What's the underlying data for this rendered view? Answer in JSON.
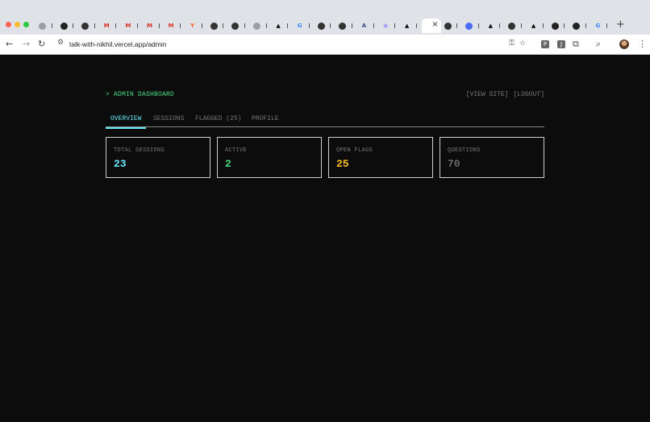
{
  "browser": {
    "tabs": [
      {
        "icon": "chrome-icon",
        "glyph": "",
        "color": "#9aa0a6"
      },
      {
        "icon": "github-icon",
        "glyph": "",
        "color": "#222222"
      },
      {
        "icon": "openai-icon",
        "glyph": "",
        "color": "#333333"
      },
      {
        "icon": "gmail-icon",
        "glyph": "M",
        "color": "#d93025"
      },
      {
        "icon": "gmail-icon",
        "glyph": "M",
        "color": "#d93025"
      },
      {
        "icon": "gmail-icon",
        "glyph": "M",
        "color": "#d93025"
      },
      {
        "icon": "gmail-icon",
        "glyph": "M",
        "color": "#d93025"
      },
      {
        "icon": "ycombinator-icon",
        "glyph": "Y",
        "color": "#f26522"
      },
      {
        "icon": "openai-icon",
        "glyph": "",
        "color": "#333333"
      },
      {
        "icon": "openai-icon",
        "glyph": "",
        "color": "#333333"
      },
      {
        "icon": "chrome-icon",
        "glyph": "",
        "color": "#9aa0a6"
      },
      {
        "icon": "vercel-icon",
        "glyph": "▲",
        "color": "#111111"
      },
      {
        "icon": "google-icon",
        "glyph": "G",
        "color": "#4285f4"
      },
      {
        "icon": "openai-icon",
        "glyph": "",
        "color": "#333333"
      },
      {
        "icon": "notion-icon",
        "glyph": "",
        "color": "#333333"
      },
      {
        "icon": "a-icon",
        "glyph": "A",
        "color": "#3b4a8c"
      },
      {
        "icon": "eye-icon",
        "glyph": "◉",
        "color": "#a78bfa"
      },
      {
        "icon": "vercel-icon",
        "glyph": "▲",
        "color": "#111111"
      },
      {
        "icon": "blank-icon",
        "glyph": "",
        "color": "#ffffff",
        "active": true
      },
      {
        "icon": "openai-icon",
        "glyph": "",
        "color": "#333333"
      },
      {
        "icon": "grid-icon",
        "glyph": "",
        "color": "#4a6cf7"
      },
      {
        "icon": "vercel-icon",
        "glyph": "▲",
        "color": "#111111"
      },
      {
        "icon": "openai-icon",
        "glyph": "",
        "color": "#333333"
      },
      {
        "icon": "vercel-icon",
        "glyph": "▲",
        "color": "#111111"
      },
      {
        "icon": "github-icon",
        "glyph": "",
        "color": "#222222"
      },
      {
        "icon": "github-icon",
        "glyph": "",
        "color": "#222222"
      },
      {
        "icon": "google-icon",
        "glyph": "G",
        "color": "#4285f4"
      }
    ],
    "url": "talk-with-nikhil.vercel.app/admin"
  },
  "header": {
    "title": "> ADMIN DASHBOARD",
    "view_site": "[VIEW SITE]",
    "logout": "[LOGOUT]"
  },
  "tabs": [
    {
      "label": "OVERVIEW",
      "active": true
    },
    {
      "label": "SESSIONS"
    },
    {
      "label": "FLAGGED (25)"
    },
    {
      "label": "PROFILE"
    }
  ],
  "stats": [
    {
      "label": "TOTAL SESSIONS",
      "value": "23",
      "color": "#67e8f9"
    },
    {
      "label": "ACTIVE",
      "value": "2",
      "color": "#4ade80"
    },
    {
      "label": "OPEN FLAGS",
      "value": "25",
      "color": "#fbbf24"
    },
    {
      "label": "QUESTIONS",
      "value": "70",
      "color": "#6b6b6b"
    }
  ]
}
